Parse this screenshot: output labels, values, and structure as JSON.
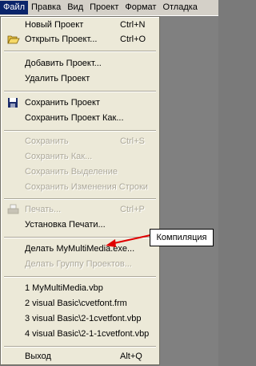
{
  "menubar": {
    "items": [
      {
        "label": "Файл",
        "active": true
      },
      {
        "label": "Правка"
      },
      {
        "label": "Вид"
      },
      {
        "label": "Проект"
      },
      {
        "label": "Формат"
      },
      {
        "label": "Отладка"
      }
    ]
  },
  "menu": {
    "new_project": {
      "label": "Новый Проект",
      "shortcut": "Ctrl+N"
    },
    "open_project": {
      "label": "Открыть Проект...",
      "shortcut": "Ctrl+O",
      "icon": "open-folder-icon"
    },
    "add_project": {
      "label": "Добавить Проект..."
    },
    "remove_project": {
      "label": "Удалить Проект"
    },
    "save_project": {
      "label": "Сохранить Проект",
      "icon": "floppy-disk-icon"
    },
    "save_project_as": {
      "label": "Сохранить Проект Как..."
    },
    "save": {
      "label": "Сохранить",
      "shortcut": "Ctrl+S",
      "disabled": true
    },
    "save_as": {
      "label": "Сохранить Как...",
      "disabled": true
    },
    "save_selection": {
      "label": "Сохранить Выделение",
      "disabled": true
    },
    "save_changes": {
      "label": "Сохранить Изменения Строки",
      "disabled": true
    },
    "print": {
      "label": "Печать...",
      "shortcut": "Ctrl+P",
      "disabled": true,
      "icon": "printer-icon"
    },
    "print_setup": {
      "label": "Установка Печати..."
    },
    "make_exe": {
      "label": "Делать MyMultiMedia.exe..."
    },
    "make_group": {
      "label": "Делать Группу Проектов...",
      "disabled": true
    },
    "recent": [
      "1 MyMultiMedia.vbp",
      "2 visual Basic\\cvetfont.frm",
      "3 visual Basic\\2-1cvetfont.vbp",
      "4 visual Basic\\2-1-1cvetfont.vbp"
    ],
    "exit": {
      "label": "Выход",
      "shortcut": "Alt+Q"
    }
  },
  "annotation": {
    "label": "Компиляция",
    "arrow_color": "#e00000"
  },
  "colors": {
    "menu_bg": "#ece9d8",
    "highlight": "#0a246a",
    "disabled_text": "#aca899"
  }
}
